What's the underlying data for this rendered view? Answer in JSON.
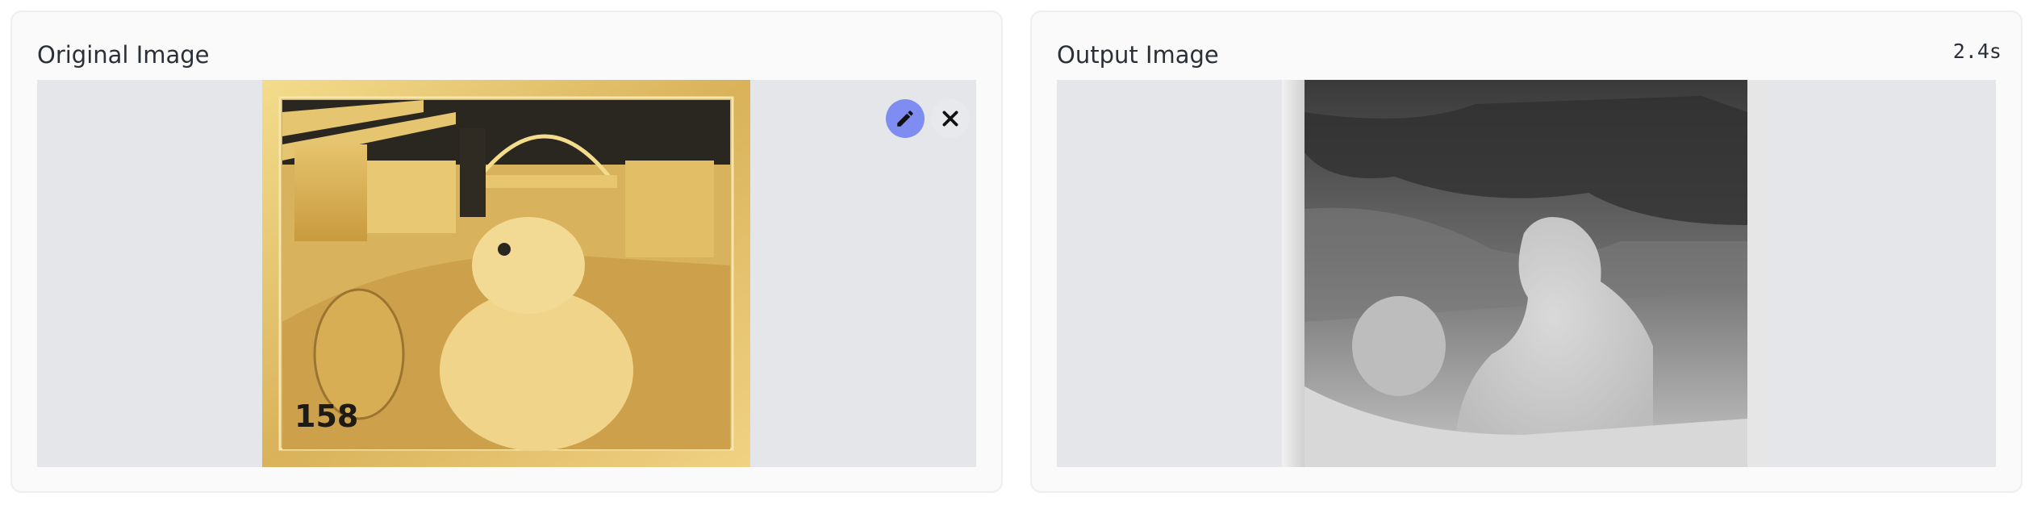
{
  "left_panel": {
    "title": "Original Image"
  },
  "right_panel": {
    "title": "Output Image",
    "timing": "2.4s"
  },
  "icons": {
    "edit": "pencil-icon",
    "close": "close-icon"
  },
  "colors": {
    "edit_button": "#7f8cf1",
    "close_button": "#e8e9ed",
    "canvas_bg": "#e5e6ea"
  }
}
